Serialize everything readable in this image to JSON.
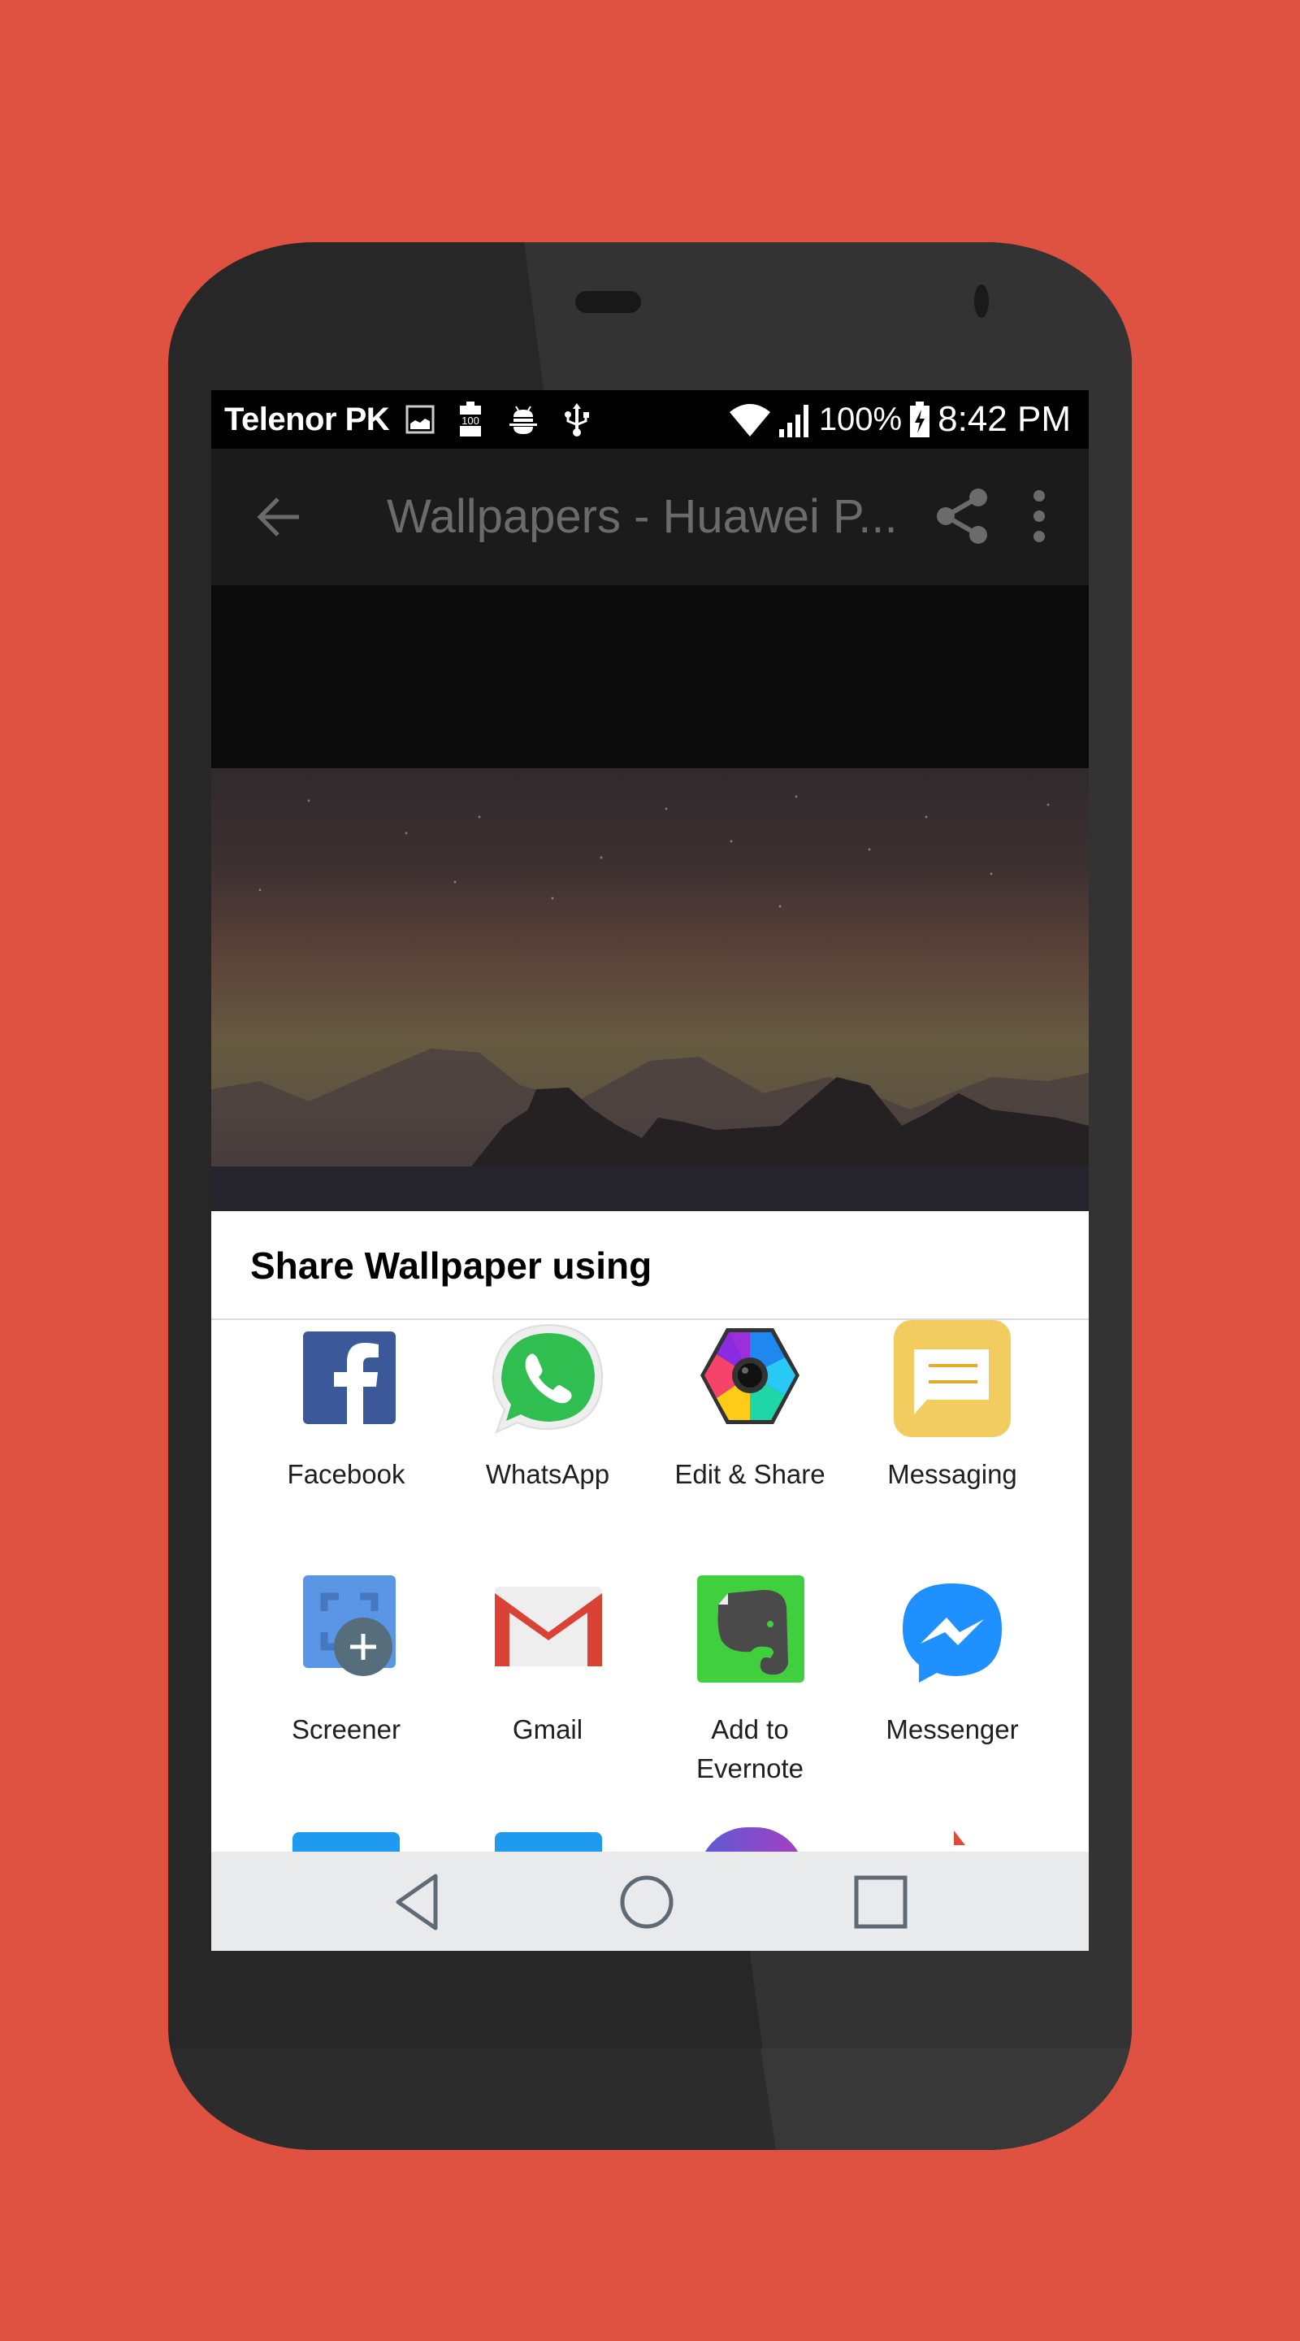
{
  "colors": {
    "background": "#DF5242",
    "toolbar_text": "#6b6b6b",
    "facebook": "#3B5998",
    "whatsapp": "#2FBE4F",
    "messaging": "#F2CC5F",
    "screener": "#5B95E5",
    "gmail": "#D94235",
    "evernote": "#3FCF3F",
    "messenger": "#1E90FF"
  },
  "status_bar": {
    "carrier": "Telenor PK",
    "left_icons": [
      "gallery-icon",
      "battery-saver-100-icon",
      "android-debug-icon",
      "usb-icon"
    ],
    "right_icons": [
      "wifi-icon",
      "signal-icon"
    ],
    "battery_percent": "100%",
    "battery_icon": "battery-charging-icon",
    "time": "8:42 PM"
  },
  "toolbar": {
    "back_icon": "arrow-back-icon",
    "title": "Wallpapers - Huawei P...",
    "share_icon": "share-icon",
    "more_icon": "more-vert-icon"
  },
  "share_sheet": {
    "title": "Share Wallpaper using",
    "apps": [
      {
        "label": "Facebook",
        "icon": "facebook-icon"
      },
      {
        "label": "WhatsApp",
        "icon": "whatsapp-icon"
      },
      {
        "label": "Edit & Share",
        "icon": "edit-share-icon"
      },
      {
        "label": "Messaging",
        "icon": "messaging-icon"
      },
      {
        "label": "Screener",
        "icon": "screener-icon"
      },
      {
        "label": "Gmail",
        "icon": "gmail-icon"
      },
      {
        "label": "Add to Evernote",
        "icon": "evernote-icon"
      },
      {
        "label": "Messenger",
        "icon": "messenger-icon"
      }
    ]
  },
  "nav_bar": {
    "back": "nav-back-icon",
    "home": "nav-home-icon",
    "recents": "nav-recents-icon"
  }
}
